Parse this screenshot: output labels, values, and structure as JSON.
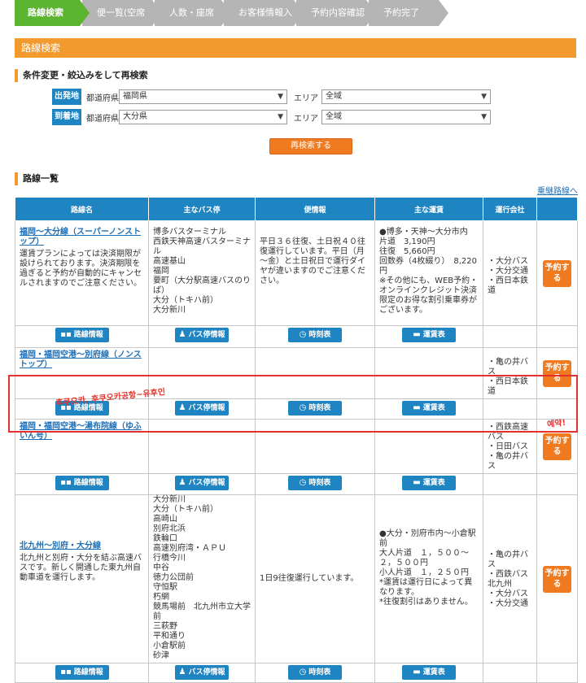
{
  "steps": [
    "路線検索",
    "便一覧(空席照会)",
    "人数・座席条件",
    "お客様情報入力",
    "予約内容確認",
    "予約完了"
  ],
  "section_title": "路線検索",
  "search": {
    "heading": "条件変更・絞込みをして再検索",
    "departure": {
      "tag": "出発地",
      "pref_label": "都道府県",
      "pref_value": "福岡県",
      "area_label": "エリア",
      "area_value": "全域"
    },
    "arrival": {
      "tag": "到着地",
      "pref_label": "都道府県",
      "pref_value": "大分県",
      "area_label": "エリア",
      "area_value": "全域"
    },
    "button": "再検索する"
  },
  "list": {
    "heading": "路線一覧",
    "link": "乗継路線へ",
    "columns": [
      "路線名",
      "主なバス停",
      "便情報",
      "主な運賃",
      "運行会社",
      ""
    ],
    "btn_route": "路線情報",
    "btn_stop": "バス停情報",
    "btn_time": "時刻表",
    "btn_fare": "運賃表",
    "btn_reserve": "予約する",
    "rows": [
      {
        "name": "福岡～大分線（スーパーノンストップ）",
        "desc": "運賃プランによっては決済期限が設けられております。決済期限を過ぎると予約が自動的にキャンセルされますのでご注意ください。",
        "stops": [
          "博多バスターミナル",
          "西鉄天神高速バスターミナル",
          "高速基山",
          "福岡",
          "要町（大分駅高速バスのりば）",
          "大分（トキハ前）",
          "大分新川"
        ],
        "info": "平日３６往復、土日祝４０往復運行しています。平日（月～金）と土日祝日で運行ダイヤが違いますのでご注意ください。",
        "fare": "●博多・天神～大分市内\n片道　3,190円\n往復　5,660円\n回数券（4枚綴り）　8,220円\n※その他にも、WEB予約・オンラインクレジット決済限定のお得な割引乗車券がございます。",
        "ops": [
          "・大分バス",
          "・大分交通",
          "・西日本鉄道"
        ]
      },
      {
        "name": "福岡・福岡空港～別府線（ノンストップ）",
        "desc": "",
        "stops": [],
        "info": "",
        "fare": "",
        "ops": [
          "・亀の井バス",
          "・西日本鉄道"
        ]
      },
      {
        "name": "福岡・福岡空港～湯布院線（ゆふいん号）",
        "desc": "",
        "stops": [],
        "info": "",
        "fare": "",
        "ops": [
          "・西鉄高速バス",
          "・日田バス",
          "・亀の井バス"
        ]
      },
      {
        "name": "北九州～別府・大分線",
        "desc": "北九州と別府・大分を結ぶ高速バスです。新しく開通した東九州自動車道を運行します。",
        "stops": [
          "大分新川",
          "大分（トキハ前）",
          "高崎山",
          "別府北浜",
          "鉄輪口",
          "高速別府湾・ＡＰＵ",
          "行橋今川",
          "中谷",
          "徳力公団前",
          "守恒駅",
          "朽網",
          "競馬場前　北九州市立大学前",
          "三萩野",
          "平和通り",
          "小倉駅前",
          "砂津"
        ],
        "info": "1日9往復運行しています。",
        "fare": "●大分・別府市内～小倉駅前\n大人片道　１，５００～２，５００円\n小人片道　１，２５０円\n*運賃は運行日によって異なります。\n*往復割引はありません。",
        "ops": [
          "・亀の井バス",
          "・西鉄バス北九州",
          "・大分バス",
          "・大分交通"
        ]
      }
    ]
  },
  "annotation": {
    "text1": "후쿠오카, 후쿠오카공항~유후인",
    "text2": "예약!"
  }
}
